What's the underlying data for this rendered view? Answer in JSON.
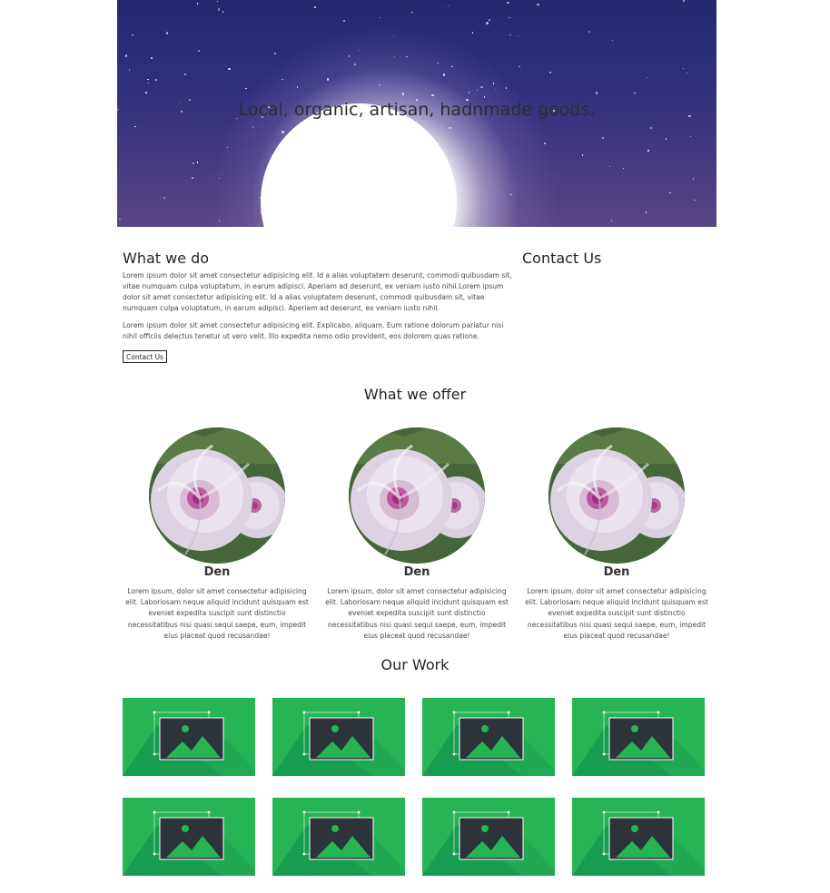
{
  "hero": {
    "title": "Local, organic, artisan, hadnmade goods."
  },
  "about": {
    "heading": "What we do",
    "paragraph1": "Lorem ipsum dolor sit amet consectetur adipisicing elit. Id a alias voluptatem deserunt, commodi quibusdam sit, vitae numquam culpa voluptatum, in earum adipisci. Aperiam ad deserunt, ex veniam iusto nihil.Lorem ipsum dolor sit amet consectetur adipisicing elit. Id a alias voluptatem deserunt, commodi quibusdam sit, vitae numquam culpa voluptatum, in earum adipisci. Aperiam ad deserunt, ex veniam iusto nihil.",
    "paragraph2": "Lorem ipsum dolor sit amet consectetur adipisicing elit. Explicabo, aliquam. Eum ratione dolorum pariatur nisi nihil officiis delectus tenetur ut vero velit. Illo expedita nemo odio provident, eos dolorem quas ratione.",
    "button_label": "Contact Us"
  },
  "contact": {
    "heading": "Contact Us"
  },
  "offer": {
    "heading": "What we offer",
    "items": [
      {
        "name": "Den",
        "description": "Lorem ipsum, dolor sit amet consectetur adipisicing elit. Laboriosam neque aliquid incidunt quisquam est eveniet expedita suscipit sunt distinctio necessitatibus nisi quasi sequi saepe, eum, impedit eius placeat quod recusandae!"
      },
      {
        "name": "Den",
        "description": "Lorem ipsum, dolor sit amet consectetur adipisicing elit. Laboriosam neque aliquid incidunt quisquam est eveniet expedita suscipit sunt distinctio necessitatibus nisi quasi sequi saepe, eum, impedit eius placeat quod recusandae!"
      },
      {
        "name": "Den",
        "description": "Lorem ipsum, dolor sit amet consectetur adipisicing elit. Laboriosam neque aliquid incidunt quisquam est eveniet expedita suscipit sunt distinctio necessitatibus nisi quasi sequi saepe, eum, impedit eius placeat quod recusandae!"
      }
    ]
  },
  "work": {
    "heading": "Our Work",
    "thumbnail_icon": "image-placeholder-icon",
    "thumbnail_count": 8
  },
  "colors": {
    "hero_top": "#23276f",
    "hero_bottom": "#5a4785",
    "thumbnail_green": "#27b455",
    "thumbnail_dark_green": "#0b8b4b",
    "icon_dark": "#2c3339"
  }
}
